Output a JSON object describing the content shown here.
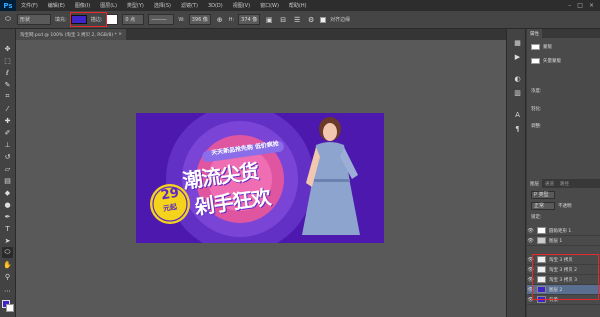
{
  "app": {
    "logo": "Ps"
  },
  "menu": [
    "文件(F)",
    "编辑(E)",
    "图像(I)",
    "图层(L)",
    "类型(Y)",
    "选择(S)",
    "滤镜(T)",
    "3D(D)",
    "视图(V)",
    "窗口(W)",
    "帮助(H)"
  ],
  "window_controls": [
    "–",
    "□",
    "×"
  ],
  "options": {
    "shape_mode": "形状",
    "fill_label": "填充:",
    "stroke_label": "描边:",
    "stroke_width": "0 点",
    "w_label": "W:",
    "w_value": "396 像",
    "link": "⊕",
    "h_label": "H:",
    "h_value": "374 像",
    "align_edges": "对齐边缘",
    "fill_color": "#3d25c9"
  },
  "document_tab": "淘宝网.psd @ 100% (淘宝 3 拷贝 2, RGB/8) *",
  "banner": {
    "top_tags": "天天新品抢先购 低价疯抢",
    "headline_1": "潮流尖货",
    "headline_2": "剁手狂欢",
    "price": "29",
    "price_unit": "元起"
  },
  "panels": {
    "top_tabs": [
      "属性"
    ],
    "properties": [
      {
        "label": "蒙版"
      },
      {
        "label": "矢量蒙版"
      }
    ],
    "density_label": "浓度:",
    "feather_label": "羽化:",
    "refine_label": "调整:",
    "layer_tabs": [
      "图层",
      "通道",
      "路径"
    ],
    "kind_label": "P 类型",
    "blend_mode": "正常",
    "opacity": "不透明",
    "lock_label": "锁定:",
    "layers": [
      "圆角矩形 1",
      "图层 1",
      "淘宝 3 拷贝",
      "淘宝 3 拷贝 2",
      "淘宝 3 拷贝 3",
      "图层 2",
      "背景"
    ]
  },
  "colors": {
    "accent": "#3d25c9",
    "highlight": "#e8282b"
  }
}
